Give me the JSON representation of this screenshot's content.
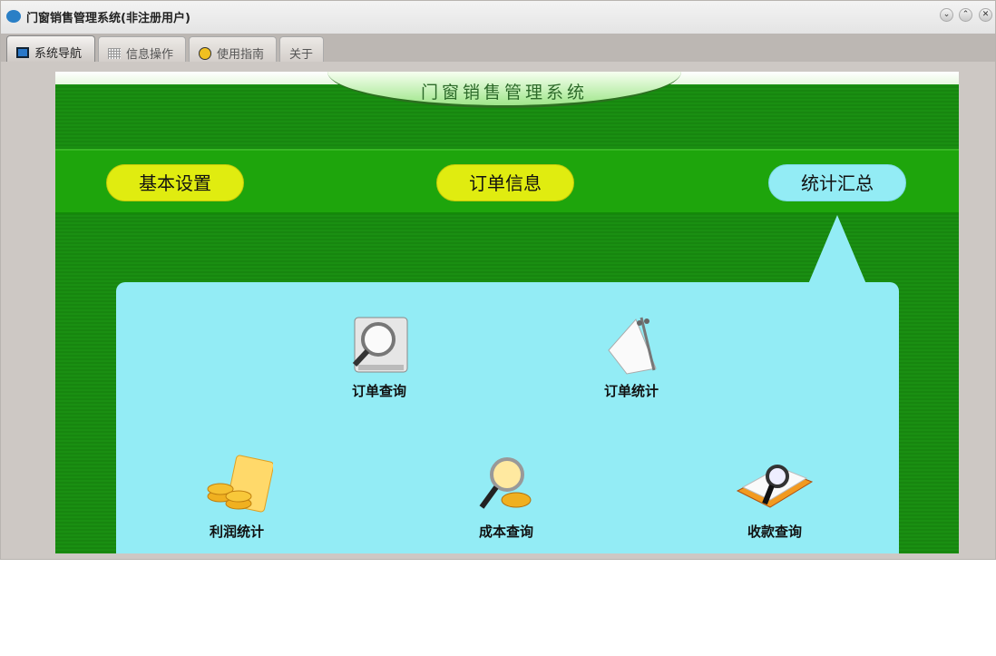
{
  "window": {
    "title": "门窗销售管理系统(非注册用户)",
    "buttons": [
      "minimize",
      "maximize",
      "close"
    ]
  },
  "tabs": [
    {
      "label": "系统导航",
      "icon": "monitor-icon",
      "active": true
    },
    {
      "label": "信息操作",
      "icon": "grid-icon",
      "active": false
    },
    {
      "label": "使用指南",
      "icon": "help-icon",
      "active": false
    },
    {
      "label": "关于",
      "icon": "",
      "active": false
    }
  ],
  "banner": {
    "title": "门窗销售管理系统"
  },
  "nav": [
    {
      "label": "基本设置",
      "selected": false
    },
    {
      "label": "订单信息",
      "selected": false
    },
    {
      "label": "统计汇总",
      "selected": true
    }
  ],
  "functions": [
    {
      "label": "订单查询",
      "icon": "magnifier-film-icon"
    },
    {
      "label": "订单统计",
      "icon": "notepad-icon"
    },
    {
      "label": "利润统计",
      "icon": "coins-icon"
    },
    {
      "label": "成本查询",
      "icon": "coin-magnifier-icon"
    },
    {
      "label": "收款查询",
      "icon": "book-magnifier-icon"
    }
  ],
  "colors": {
    "background_green": "#17860f",
    "nav_button": "#e0ec10",
    "selected": "#93ecf5"
  }
}
